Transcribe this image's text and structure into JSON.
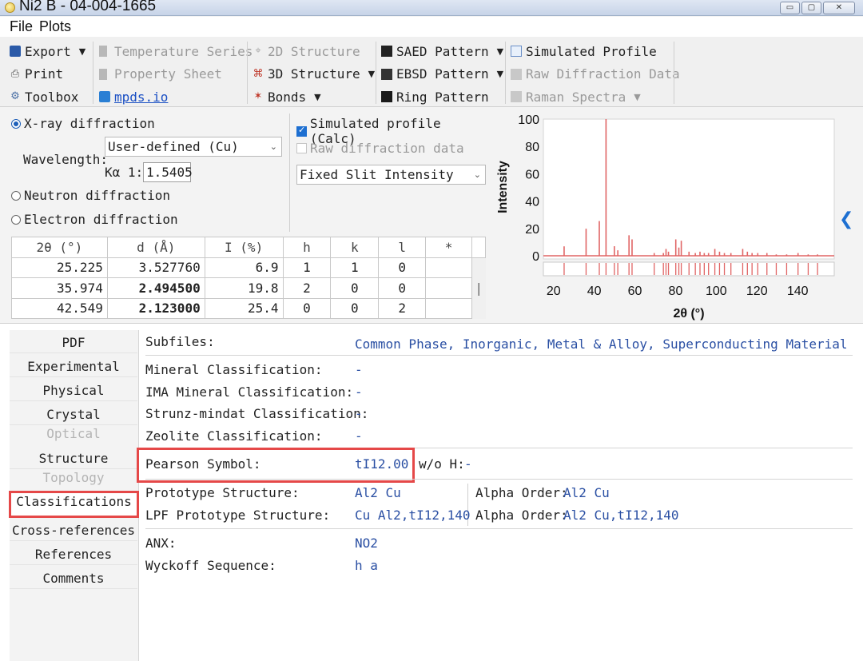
{
  "window": {
    "title": "Ni2 B - 04-004-1665",
    "min_glyph": "▭",
    "max_glyph": "▢",
    "close_glyph": "✕"
  },
  "menu": [
    "File",
    "Plots"
  ],
  "toolbar": {
    "export": "Export",
    "print": "Print",
    "toolbox": "Toolbox",
    "temperature_series": "Temperature Series",
    "property_sheet": "Property Sheet",
    "mpds": "mpds.io",
    "structure_2d": "2D Structure",
    "structure_3d": "3D Structure",
    "bonds": "Bonds",
    "saed": "SAED Pattern",
    "ebsd": "EBSD Pattern",
    "ring": "Ring Pattern",
    "simulated_profile": "Simulated Profile",
    "raw_diffraction": "Raw Diffraction Data",
    "raman": "Raman Spectra"
  },
  "diffraction": {
    "xray": "X-ray diffraction",
    "wavelength_label": "Wavelength:",
    "wavelength_select": "User-defined (Cu)",
    "ka1_label": "Kα 1:",
    "ka1_value": "1.5405",
    "neutron": "Neutron diffraction",
    "electron": "Electron diffraction",
    "simulated_profile": "Simulated profile (Calc)",
    "raw_data": "Raw diffraction data",
    "intensity_mode": "Fixed Slit Intensity"
  },
  "peaks": {
    "headers": [
      "2θ (°)",
      "d (Å)",
      "I (%)",
      "h",
      "k",
      "l",
      "*"
    ],
    "rows": [
      [
        "25.225",
        "3.527760",
        "6.9",
        "1",
        "1",
        "0",
        ""
      ],
      [
        "35.974",
        "2.494500",
        "19.8",
        "2",
        "0",
        "0",
        ""
      ],
      [
        "42.549",
        "2.123000",
        "25.4",
        "0",
        "0",
        "2",
        ""
      ]
    ],
    "scroll_glyph": "|"
  },
  "chart_data": {
    "type": "bar",
    "xlabel": "2θ (°)",
    "ylabel": "Intensity",
    "xlim": [
      15,
      158
    ],
    "ylim": [
      0,
      100
    ],
    "xticks": [
      20,
      40,
      60,
      80,
      100,
      120,
      140
    ],
    "yticks": [
      0,
      20,
      40,
      60,
      80,
      100
    ],
    "grid": false,
    "color": "#e06565",
    "peaks": [
      {
        "x": 25.2,
        "y": 6.9
      },
      {
        "x": 36.0,
        "y": 19.8
      },
      {
        "x": 42.5,
        "y": 25.4
      },
      {
        "x": 45.8,
        "y": 100
      },
      {
        "x": 49.9,
        "y": 7
      },
      {
        "x": 51.6,
        "y": 4
      },
      {
        "x": 57.1,
        "y": 15
      },
      {
        "x": 58.6,
        "y": 12
      },
      {
        "x": 69.5,
        "y": 2
      },
      {
        "x": 74.0,
        "y": 2
      },
      {
        "x": 75.3,
        "y": 5
      },
      {
        "x": 76.5,
        "y": 3
      },
      {
        "x": 80.1,
        "y": 12
      },
      {
        "x": 81.6,
        "y": 6
      },
      {
        "x": 82.8,
        "y": 11
      },
      {
        "x": 86.6,
        "y": 3
      },
      {
        "x": 89.7,
        "y": 2
      },
      {
        "x": 92.0,
        "y": 3
      },
      {
        "x": 94.1,
        "y": 2
      },
      {
        "x": 96.2,
        "y": 2
      },
      {
        "x": 99.3,
        "y": 5
      },
      {
        "x": 101.6,
        "y": 3
      },
      {
        "x": 104.0,
        "y": 2
      },
      {
        "x": 107.2,
        "y": 2
      },
      {
        "x": 113.0,
        "y": 5
      },
      {
        "x": 115.3,
        "y": 3
      },
      {
        "x": 117.6,
        "y": 2
      },
      {
        "x": 120.4,
        "y": 2
      },
      {
        "x": 124.9,
        "y": 2
      },
      {
        "x": 129.5,
        "y": 1
      },
      {
        "x": 134.6,
        "y": 1
      },
      {
        "x": 140.2,
        "y": 2
      },
      {
        "x": 145.2,
        "y": 1
      },
      {
        "x": 149.8,
        "y": 1
      }
    ]
  },
  "collapse_glyph": "❮",
  "nav": {
    "pdf": "PDF",
    "experimental": "Experimental",
    "physical": "Physical",
    "crystal": "Crystal",
    "optical": "Optical",
    "structure": "Structure",
    "topology": "Topology",
    "classifications": "Classifications",
    "cross_references": "Cross-references",
    "references": "References",
    "comments": "Comments"
  },
  "classifications": {
    "subfiles_label": "Subfiles:",
    "subfiles_value": "Common Phase, Inorganic, Metal & Alloy, Superconducting Material",
    "mineral_label": "Mineral Classification:",
    "mineral_value": "-",
    "ima_label": "IMA Mineral Classification:",
    "ima_value": "-",
    "strunz_label": "Strunz-mindat Classification:",
    "strunz_value": "-",
    "zeolite_label": "Zeolite Classification:",
    "zeolite_value": "-",
    "pearson_label": "Pearson Symbol:",
    "pearson_value": "tI12.00",
    "woh_label": "w/o H:",
    "woh_value": "-",
    "prototype_label": "Prototype Structure:",
    "prototype_value": "Al2 Cu",
    "alpha_label": "Alpha Order:",
    "prototype_alpha": "Al2 Cu",
    "lpf_label": "LPF Prototype Structure:",
    "lpf_value": "Cu Al2,tI12,140",
    "lpf_alpha": "Al2 Cu,tI12,140",
    "anx_label": "ANX:",
    "anx_value": "NO2",
    "wyckoff_label": "Wyckoff Sequence:",
    "wyckoff_value": "h a"
  }
}
